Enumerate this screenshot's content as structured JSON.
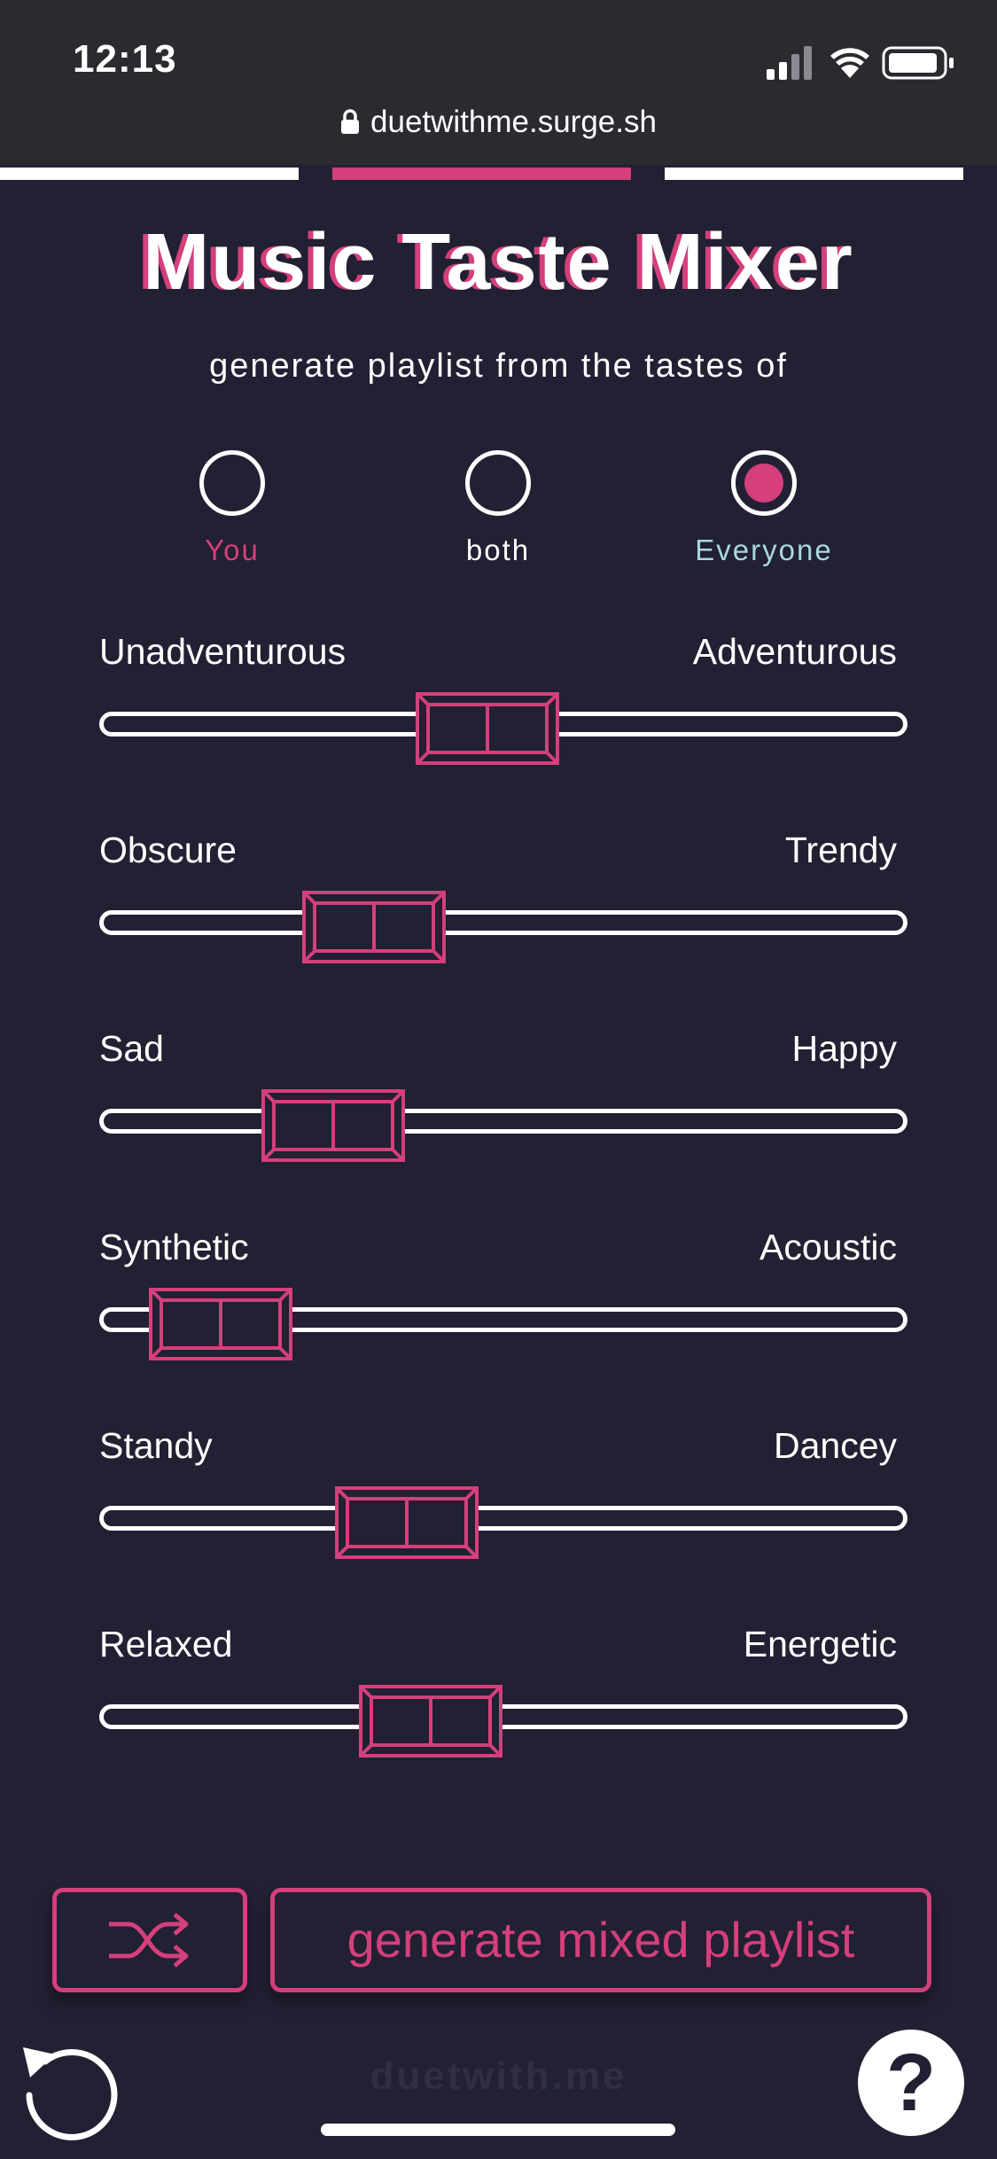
{
  "status_bar": {
    "time": "12:13",
    "icons": [
      "signal-icon",
      "wifi-icon",
      "battery-icon"
    ]
  },
  "browser": {
    "url": "duetwithme.surge.sh",
    "lock_icon": "lock-icon"
  },
  "tabs": [
    {
      "name": "tab-1",
      "active": false
    },
    {
      "name": "tab-2",
      "active": true
    },
    {
      "name": "tab-3",
      "active": false
    }
  ],
  "header": {
    "title": "Music Taste Mixer",
    "subtitle": "generate playlist from the tastes of"
  },
  "taste_source": {
    "options": [
      {
        "label": "You",
        "selected": false,
        "color": "#d43f7c"
      },
      {
        "label": "both",
        "selected": false,
        "color": "#ffffff"
      },
      {
        "label": "Everyone",
        "selected": true,
        "color": "#a9d8dc"
      }
    ]
  },
  "sliders": [
    {
      "left_label": "Unadventurous",
      "right_label": "Adventurous",
      "value": 0.48
    },
    {
      "left_label": "Obscure",
      "right_label": "Trendy",
      "value": 0.34
    },
    {
      "left_label": "Sad",
      "right_label": "Happy",
      "value": 0.29
    },
    {
      "left_label": "Synthetic",
      "right_label": "Acoustic",
      "value": 0.15
    },
    {
      "left_label": "Standy",
      "right_label": "Dancey",
      "value": 0.38
    },
    {
      "left_label": "Relaxed",
      "right_label": "Energetic",
      "value": 0.41
    }
  ],
  "actions": {
    "shuffle_icon": "shuffle-icon",
    "generate_label": "generate mixed playlist"
  },
  "footer": {
    "brand": "duetwith.me",
    "undo_icon": "undo-icon",
    "help_label": "?"
  },
  "colors": {
    "background": "#222033",
    "accent": "#d43f7c",
    "teal": "#a9d8dc",
    "text": "#ffffff"
  }
}
